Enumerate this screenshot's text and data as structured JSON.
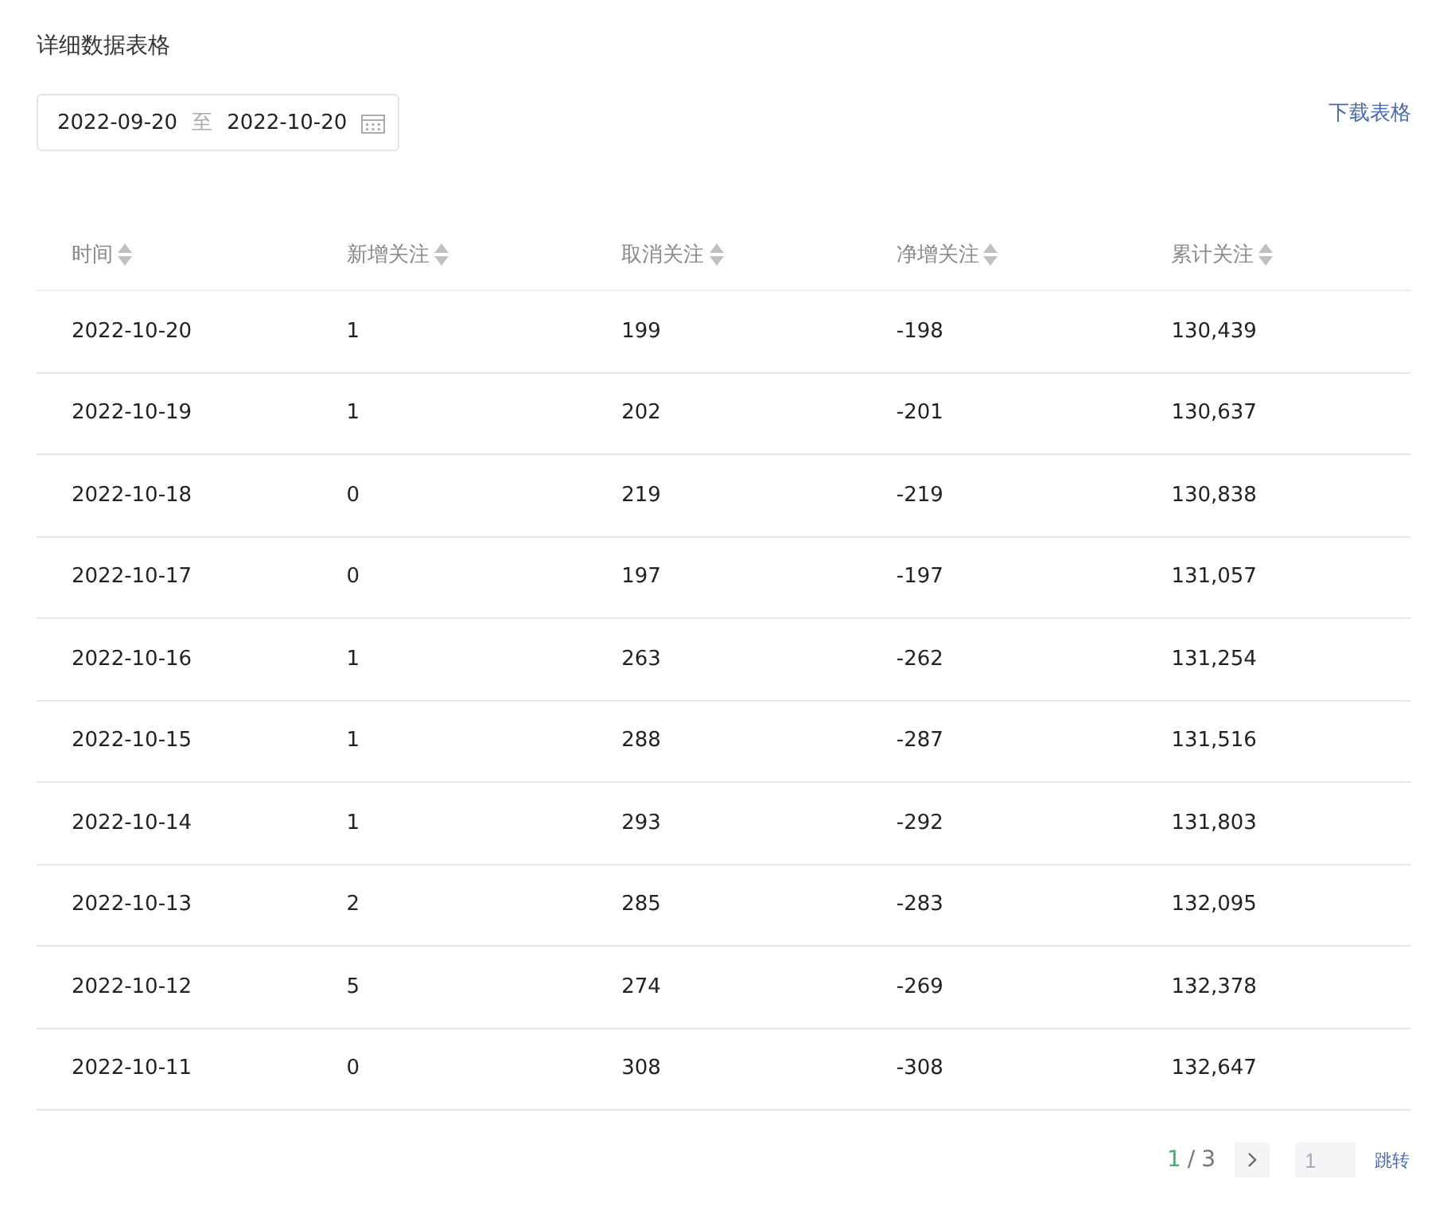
{
  "title": "详细数据表格",
  "date_range": {
    "start": "2022-09-20",
    "separator": "至",
    "end": "2022-10-20"
  },
  "download_link": "下载表格",
  "table": {
    "columns": [
      "时间",
      "新增关注",
      "取消关注",
      "净增关注",
      "累计关注"
    ],
    "rows": [
      [
        "2022-10-20",
        "1",
        "199",
        "-198",
        "130,439"
      ],
      [
        "2022-10-19",
        "1",
        "202",
        "-201",
        "130,637"
      ],
      [
        "2022-10-18",
        "0",
        "219",
        "-219",
        "130,838"
      ],
      [
        "2022-10-17",
        "0",
        "197",
        "-197",
        "131,057"
      ],
      [
        "2022-10-16",
        "1",
        "263",
        "-262",
        "131,254"
      ],
      [
        "2022-10-15",
        "1",
        "288",
        "-287",
        "131,516"
      ],
      [
        "2022-10-14",
        "1",
        "293",
        "-292",
        "131,803"
      ],
      [
        "2022-10-13",
        "2",
        "285",
        "-283",
        "132,095"
      ],
      [
        "2022-10-12",
        "5",
        "274",
        "-269",
        "132,378"
      ],
      [
        "2022-10-11",
        "0",
        "308",
        "-308",
        "132,647"
      ]
    ]
  },
  "pagination": {
    "current": "1",
    "separator": "/",
    "total": "3",
    "page_input_placeholder": "1",
    "jump_button": "跳转"
  }
}
